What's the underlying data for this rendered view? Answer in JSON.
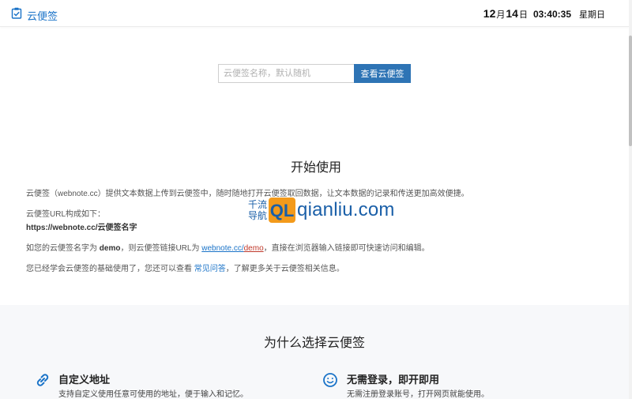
{
  "header": {
    "logo_label": "云便签",
    "date": {
      "month": "12",
      "month_unit": "月",
      "day": "14",
      "day_unit": "日"
    },
    "time": "03:40:35",
    "weekday": "星期日"
  },
  "search": {
    "placeholder": "云便签名称，默认随机",
    "button_label": "查看云便签"
  },
  "intro": {
    "title": "开始使用",
    "p1": "云便签（webnote.cc）提供文本数据上传到云便签中，随时随地打开云便签取回数据，让文本数据的记录和传送更加高效便捷。",
    "p2_line1": "云便签URL构成如下：",
    "p2_line2": "https://webnote.cc/云便签名字",
    "p3_pre": "如您的云便签名字为 ",
    "p3_name": "demo",
    "p3_mid": "，则云便签链接URL为 ",
    "p3_link_base": "webnote.cc/",
    "p3_link_name": "demo",
    "p3_post": "，直接在浏览器输入链接即可快速访问和编辑。",
    "p4_pre": "您已经学会云便签的基础使用了，您还可以查看 ",
    "p4_link": "常见问答",
    "p4_post": "，了解更多关于云便签相关信息。"
  },
  "watermark": {
    "cn_line1": "千流",
    "cn_line2": "导航",
    "logo_letters": "QL",
    "text": "qianliu.com"
  },
  "features": {
    "title": "为什么选择云便签",
    "items": [
      {
        "icon": "link-icon",
        "title": "自定义地址",
        "desc": "支持自定义使用任意可使用的地址，便于输入和记忆。"
      },
      {
        "icon": "smile-icon",
        "title": "无需登录，即开即用",
        "desc": "无需注册登录账号，打开网页就能使用。"
      }
    ]
  },
  "colors": {
    "brand": "#1a73c8",
    "button": "#2e74b5",
    "watermark_blue": "#1a5fa8",
    "watermark_orange": "#f39a1b"
  }
}
